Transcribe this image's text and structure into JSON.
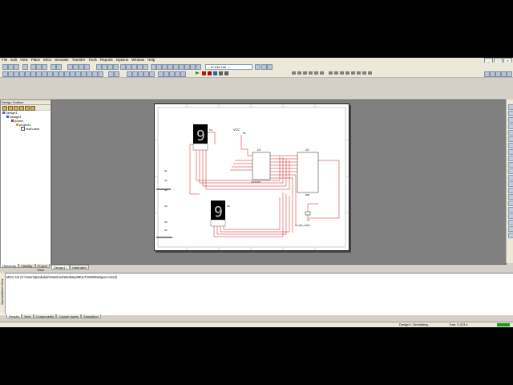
{
  "menu": [
    "File",
    "Edit",
    "View",
    "Place",
    "MCU",
    "Simulate",
    "Transfer",
    "Tools",
    "Reports",
    "Options",
    "Window",
    "Help"
  ],
  "toolbar": {
    "in_use_list": "--- In Use List ---"
  },
  "design_toolbox": {
    "title": "Design Toolbox",
    "tree": [
      {
        "label": "Design1",
        "level": 0
      },
      {
        "label": "Design1",
        "level": 1
      },
      {
        "label": "power",
        "level": 2
      },
      {
        "label": "project1",
        "level": 3
      },
      {
        "label": "main.asm",
        "level": 4
      }
    ],
    "tabs": [
      "Hierarchy",
      "Visibility",
      "Project View"
    ]
  },
  "doc_tabs": [
    "Design1 *",
    "main.asm"
  ],
  "schematic": {
    "vcc_label": "VCC",
    "vcc_value": "5V",
    "display1_value": "9",
    "display2_value": "9",
    "u1_label": "U1",
    "u2_label": "U2",
    "labels": [
      "74LS373N",
      "8051",
      "X1",
      "HC-49/U_11MHz"
    ]
  },
  "output": {
    "line": "MCU U2 (C:\\Users\\psokolyk\\OneDrive\\Desktop\\MULTISIM\\Design1.ms13)",
    "side_label": "Spreadsheet View",
    "tabs": [
      "Results",
      "Nets",
      "Components",
      "Copper layers",
      "Simulation"
    ]
  },
  "status": {
    "simulating": "Design1: Simulating...",
    "tran": "Tran: 0.023 s"
  },
  "colors": {
    "wire": "#cc0000",
    "display": "#000000",
    "segment": "#c8c8c8",
    "workspace": "#808080"
  }
}
